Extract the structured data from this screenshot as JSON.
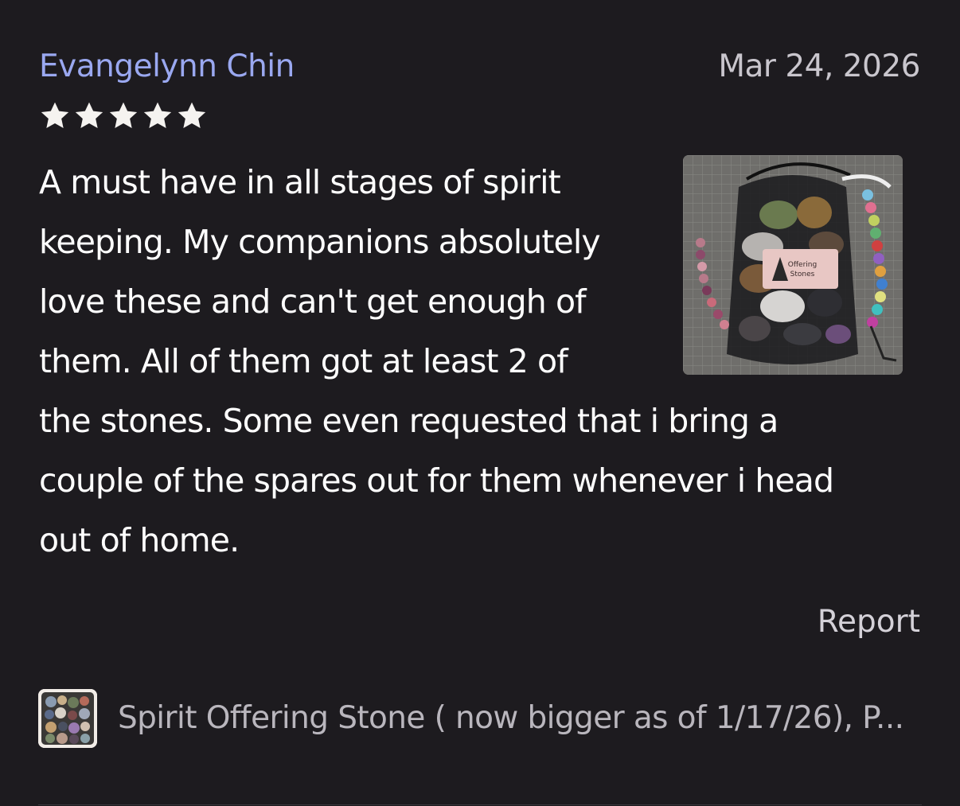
{
  "review": {
    "reviewer_name": "Evangelynn Chin",
    "date": "Mar 24, 2026",
    "rating": 5,
    "rating_max": 5,
    "body_lines": [
      "A must have in all stages of spirit",
      "keeping. My companions absolutely",
      "love these and can't get enough of",
      "them. All of them got at least 2 of",
      "the stones. Some even requested that i bring a",
      "couple of the spares out for them whenever i head",
      "out of home."
    ],
    "photo_label_line1": "Offering",
    "photo_label_line2": "Stones",
    "report_label": "Report"
  },
  "product": {
    "title": "Spirit Offering Stone ( now bigger as of 1/17/26), P..."
  },
  "colors": {
    "background": "#1d1b1f",
    "reviewer_name": "#9aa8f0",
    "star": "#f5f3f0",
    "body_text": "#ffffff",
    "muted_text": "#c9c6cd"
  }
}
